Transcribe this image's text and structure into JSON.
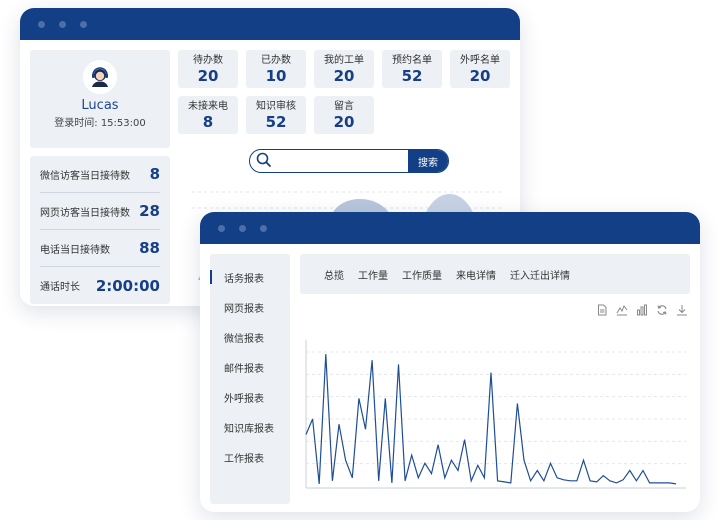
{
  "profile": {
    "name": "Lucas",
    "login_label": "登录时间:",
    "login_time": "15:53:00"
  },
  "stats": [
    {
      "label": "微信访客当日接待数",
      "value": "8"
    },
    {
      "label": "网页访客当日接待数",
      "value": "28"
    },
    {
      "label": "电话当日接待数",
      "value": "88"
    },
    {
      "label": "通话时长",
      "value": "2:00:00"
    }
  ],
  "tiles": [
    {
      "label": "待办数",
      "value": "20"
    },
    {
      "label": "已办数",
      "value": "10"
    },
    {
      "label": "我的工单",
      "value": "20"
    },
    {
      "label": "预约名单",
      "value": "52"
    },
    {
      "label": "外呼名单",
      "value": "20"
    },
    {
      "label": "未接来电",
      "value": "8"
    },
    {
      "label": "知识审核",
      "value": "52"
    },
    {
      "label": "留言",
      "value": "20"
    }
  ],
  "search": {
    "button_label": "搜索",
    "value": ""
  },
  "menu": [
    "话务报表",
    "网页报表",
    "微信报表",
    "邮件报表",
    "外呼报表",
    "知识库报表",
    "工作报表"
  ],
  "tabs": [
    "总揽",
    "工作量",
    "工作质量",
    "来电详情",
    "迁入迁出详情"
  ],
  "icons": [
    "document-icon",
    "line-chart-icon",
    "bar-chart-icon",
    "refresh-icon",
    "download-icon"
  ],
  "colors": {
    "primary": "#123f86",
    "panel": "#edf0f5",
    "line": "#1f4e96"
  },
  "chart_data": {
    "type": "line",
    "y": [
      50,
      65,
      2,
      128,
      5,
      60,
      25,
      8,
      85,
      55,
      122,
      5,
      85,
      3,
      118,
      5,
      30,
      8,
      22,
      12,
      40,
      8,
      25,
      15,
      45,
      5,
      20,
      8,
      110,
      5,
      4,
      3,
      80,
      25,
      5,
      15,
      5,
      22,
      8,
      6,
      5,
      5,
      25,
      5,
      4,
      10,
      5,
      3,
      6,
      15,
      5,
      15,
      3,
      3,
      3,
      3,
      2
    ]
  }
}
